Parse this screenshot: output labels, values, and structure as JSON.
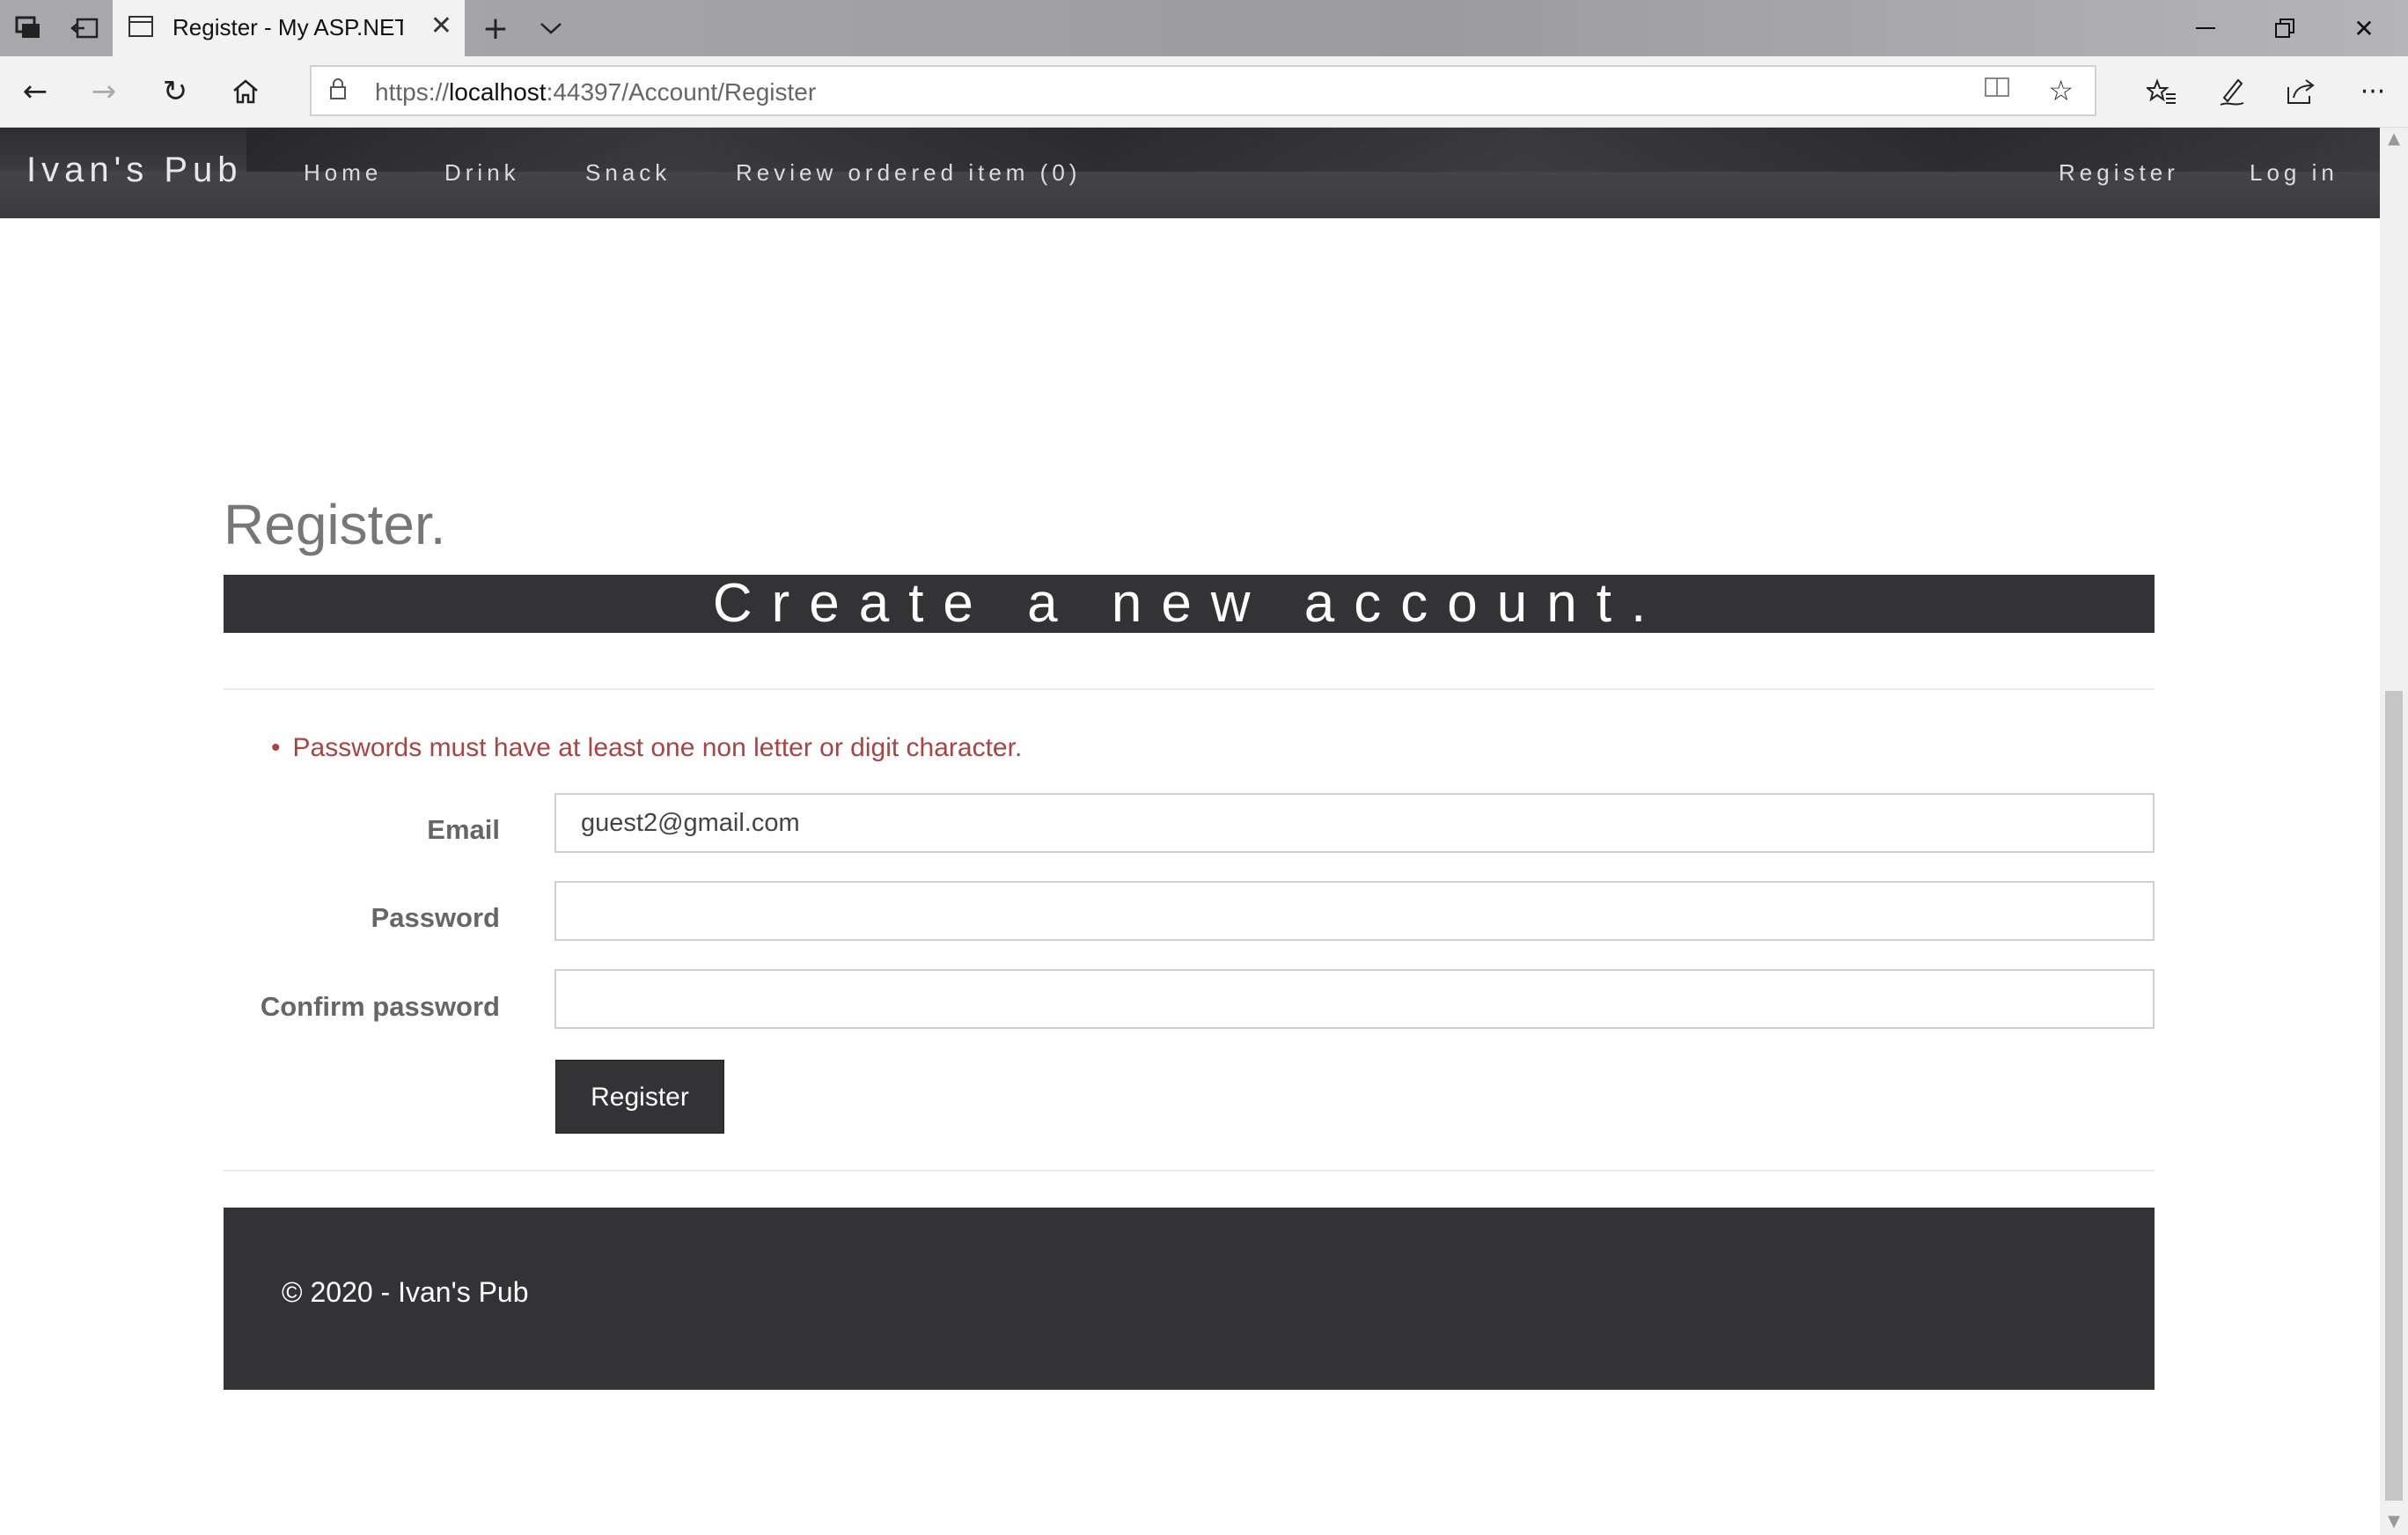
{
  "browser": {
    "tab_title": "Register - My ASP.NET /",
    "url_prefix": "https://",
    "url_host": "localhost",
    "url_rest": ":44397/Account/Register",
    "icons": {
      "tab_actions": "tab-actions-icon",
      "set_aside": "set-aside-icon",
      "new_tab": "+",
      "tab_list": "⌄",
      "close_tab": "✕",
      "minimize": "—",
      "restore": "❐",
      "close_window": "✕",
      "back": "←",
      "forward": "→",
      "refresh": "↻",
      "home": "⌂",
      "lock": "🔒",
      "reading_view": "📖",
      "favorite": "☆",
      "favorites_hub": "☆≡",
      "notes": "✎",
      "share": "⇗",
      "more": "···"
    }
  },
  "site": {
    "brand": "Ivan's Pub",
    "nav": {
      "home": "Home",
      "drink": "Drink",
      "snack": "Snack",
      "review": "Review ordered item (0)",
      "register": "Register",
      "login": "Log in"
    }
  },
  "page": {
    "title": "Register.",
    "subtitle": "Create a new account.",
    "validation_error": "Passwords must have at least one non letter or digit character.",
    "form": {
      "email_label": "Email",
      "email_value": "guest2@gmail.com",
      "password_label": "Password",
      "password_value": "",
      "confirm_label": "Confirm password",
      "confirm_value": "",
      "submit_label": "Register"
    },
    "footer": "© 2020 - Ivan's Pub"
  },
  "colors": {
    "nav_bg": "#3b3b3f",
    "dark_panel": "#333335",
    "error": "#a94442",
    "label": "#666666"
  }
}
